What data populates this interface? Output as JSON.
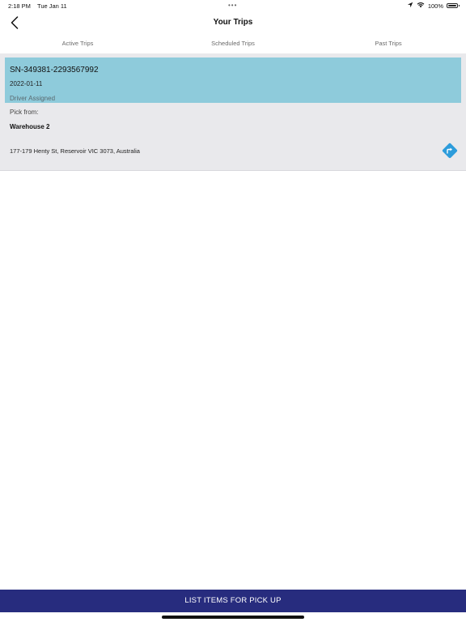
{
  "status_bar": {
    "time": "2:18 PM",
    "date": "Tue Jan 11",
    "dots": "•••",
    "battery_text": "100%"
  },
  "header": {
    "title": "Your Trips",
    "back_icon": "chevron-left-icon"
  },
  "tabs": [
    {
      "label": "Active Trips",
      "active": true
    },
    {
      "label": "Scheduled Trips",
      "active": false
    },
    {
      "label": "Past Trips",
      "active": false
    }
  ],
  "trip": {
    "id": "SN-349381-2293567992",
    "date": "2022-01-11",
    "status": "Driver Assigned",
    "pick_label": "Pick from:",
    "warehouse": "Warehouse 2",
    "address": "177-179 Henty St, Reservoir VIC 3073, Australia",
    "directions_icon": "directions-icon"
  },
  "bottom_action": {
    "label": "LIST ITEMS FOR PICK UP"
  },
  "colors": {
    "card_header": "#8ecbdb",
    "card_background": "#e9e9ec",
    "primary_button": "#272c7e",
    "directions_icon": "#2d9cdb",
    "tab_indicator": "#f4a27a"
  }
}
